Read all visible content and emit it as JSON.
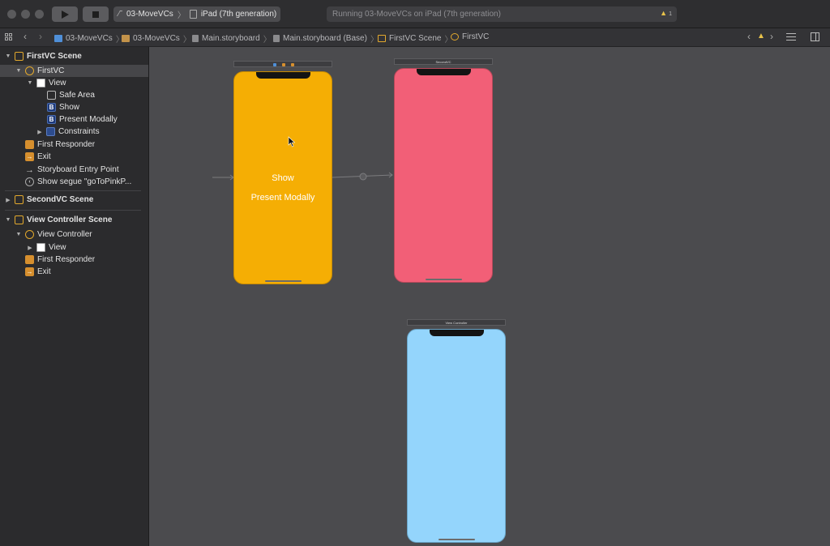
{
  "toolbar": {
    "scheme_name": "03-MoveVCs",
    "device_name": "iPad (7th generation)",
    "status_text": "Running 03-MoveVCs on iPad (7th generation)",
    "warning_count": "1"
  },
  "jumpbar": {
    "crumbs": [
      "03-MoveVCs",
      "03-MoveVCs",
      "Main.storyboard",
      "Main.storyboard (Base)",
      "FirstVC Scene",
      "FirstVC"
    ]
  },
  "navigator": {
    "first_scene": {
      "title": "FirstVC Scene",
      "controller": "FirstVC",
      "view": "View",
      "safe_area": "Safe Area",
      "show": "Show",
      "present_modally": "Present Modally",
      "constraints": "Constraints",
      "first_responder": "First Responder",
      "exit": "Exit",
      "entry_point": "Storyboard Entry Point",
      "segue": "Show segue \"goToPinkP..."
    },
    "second_scene": {
      "title": "SecondVC Scene"
    },
    "third_scene": {
      "title": "View Controller Scene",
      "controller": "View Controller",
      "view": "View",
      "first_responder": "First Responder",
      "exit": "Exit"
    }
  },
  "canvas": {
    "first_vc": {
      "show_label": "Show",
      "present_label": "Present Modally",
      "color": "#f5ae04"
    },
    "second_vc": {
      "bar_label": "SecondVC",
      "color": "#f25f77"
    },
    "third_vc": {
      "bar_label": "View Controller",
      "color": "#94d5fc"
    }
  }
}
